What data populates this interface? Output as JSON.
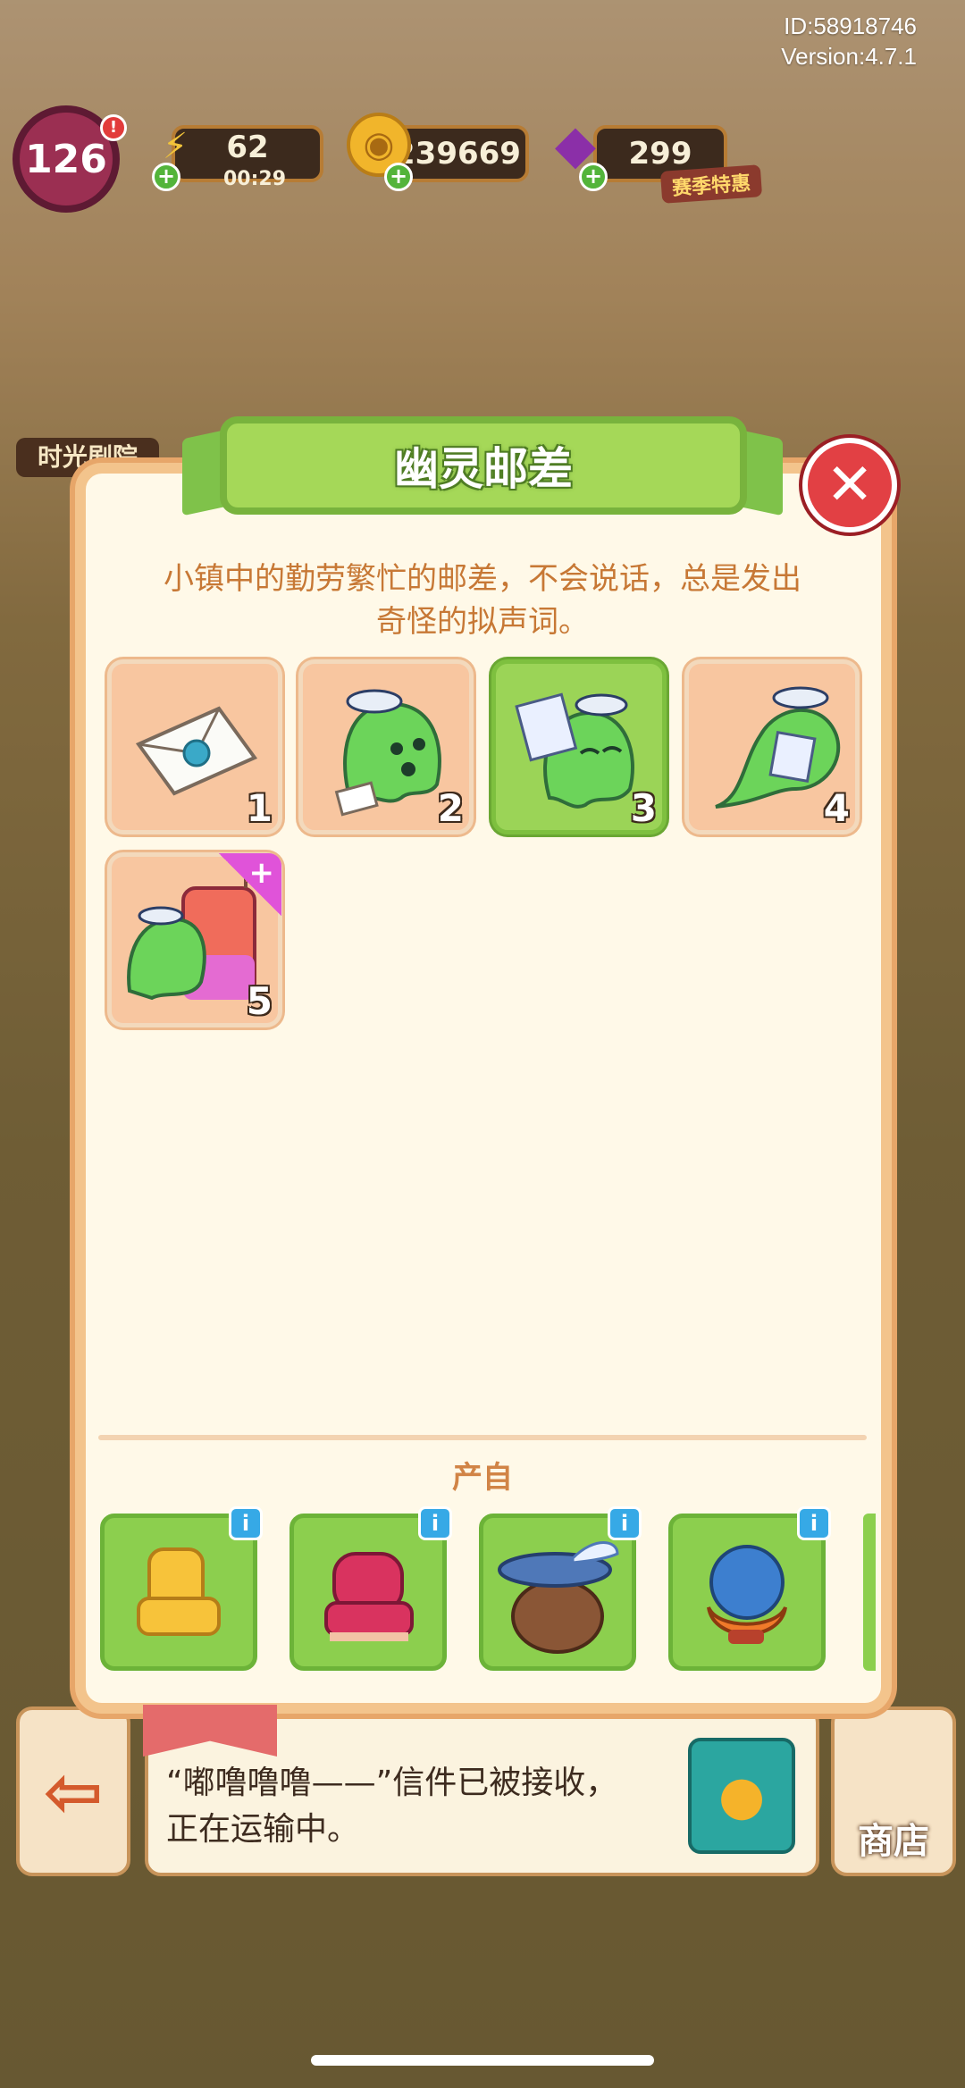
{
  "hud": {
    "id_line": "ID:58918746",
    "version_line": "Version:4.7.1",
    "level": "126",
    "energy": "62",
    "energy_timer": "00:29",
    "coins": "239669",
    "gems": "299",
    "season_tag": "赛季特惠"
  },
  "background": {
    "time_theater_label": "时光剧院"
  },
  "dialog": {
    "title": "幽灵邮差",
    "description_line1": "小镇中的勤劳繁忙的邮差，不会说话，总是发出",
    "description_line2": "奇怪的拟声词。",
    "close_icon": "close-icon",
    "stages": [
      {
        "num": "1",
        "icon": "envelope-icon",
        "active": false
      },
      {
        "num": "2",
        "icon": "ghost-postman-icon",
        "active": false
      },
      {
        "num": "3",
        "icon": "ghost-postman-letter-icon",
        "active": true
      },
      {
        "num": "4",
        "icon": "ghost-postman-flying-icon",
        "active": false
      },
      {
        "num": "5",
        "icon": "ghost-mailbox-icon",
        "active": false,
        "plus": "+"
      }
    ],
    "source_label": "产自",
    "sources": [
      {
        "icon": "yellow-chair-icon",
        "info": "i"
      },
      {
        "icon": "red-armchair-icon",
        "info": "i"
      },
      {
        "icon": "feather-hat-wig-icon",
        "info": "i"
      },
      {
        "icon": "blue-hat-hair-icon",
        "info": "i"
      }
    ]
  },
  "bottom": {
    "message_line1": "“嘟噜噜噜——”信件已被接收，",
    "message_line2": "正在运输中。",
    "shop_label": "商店"
  },
  "colors": {
    "accent_green": "#a5d858",
    "tile_peach": "#f8c6a0",
    "close_red": "#e24044",
    "desc_orange": "#c77835"
  }
}
